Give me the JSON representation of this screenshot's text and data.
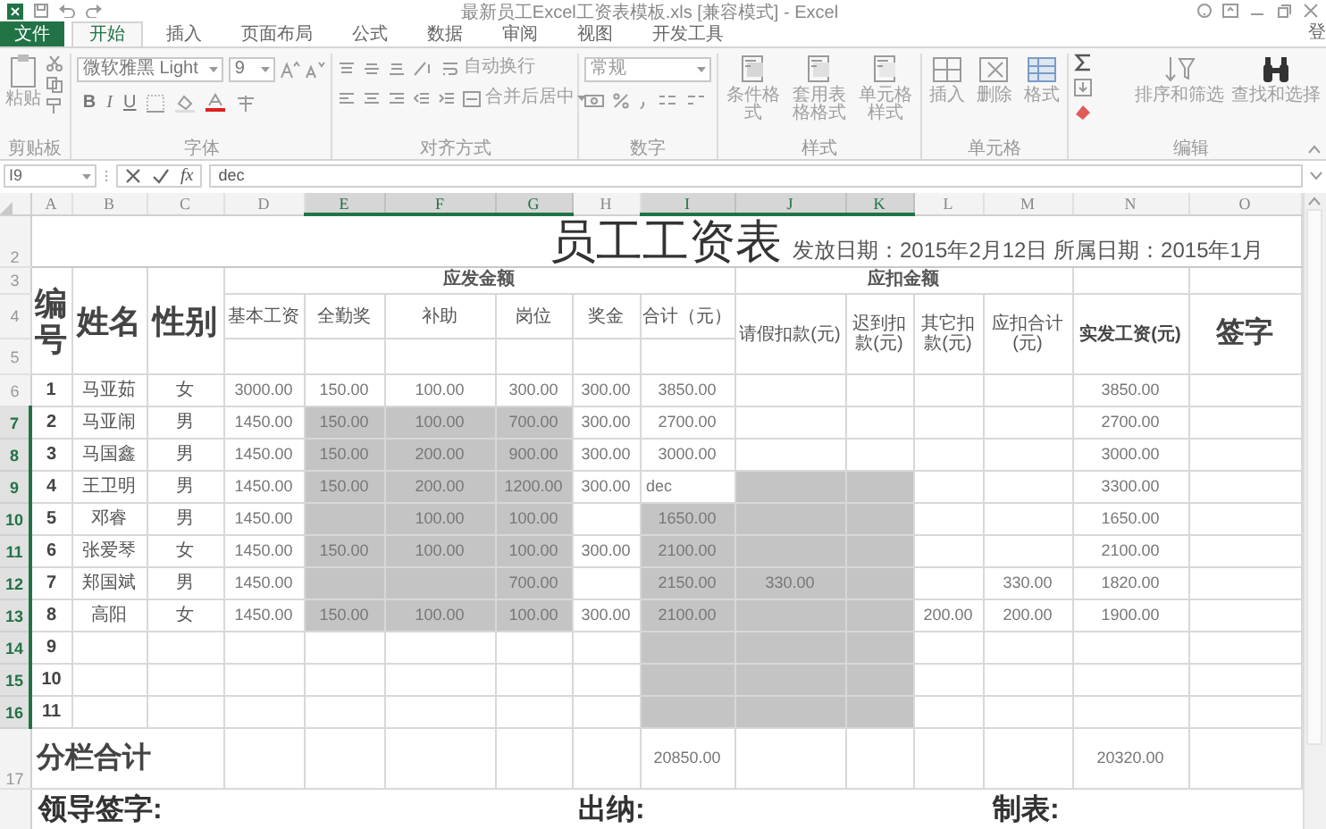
{
  "window": {
    "title": "最新员工Excel工资表模板.xls  [兼容模式] - Excel"
  },
  "ribbon": {
    "tabs": [
      {
        "label": "文件",
        "kind": "backstage",
        "selected": false
      },
      {
        "label": "开始",
        "kind": "tab",
        "selected": true
      },
      {
        "label": "插入",
        "kind": "tab",
        "selected": false
      },
      {
        "label": "页面布局",
        "kind": "tab",
        "selected": false
      },
      {
        "label": "公式",
        "kind": "tab",
        "selected": false
      },
      {
        "label": "数据",
        "kind": "tab",
        "selected": false
      },
      {
        "label": "审阅",
        "kind": "tab",
        "selected": false
      },
      {
        "label": "视图",
        "kind": "tab",
        "selected": false
      },
      {
        "label": "开发工具",
        "kind": "tab",
        "selected": false
      }
    ],
    "account": "登",
    "clipboard": {
      "label": "剪贴板",
      "paste": "粘贴"
    },
    "font": {
      "label": "字体",
      "font_name": "微软雅黑 Light",
      "font_size": "9",
      "bold": "B",
      "italic": "I",
      "underline": "U"
    },
    "alignment": {
      "label": "对齐方式",
      "wrap_text": "自动换行",
      "merge_center": "合并后居中"
    },
    "number": {
      "label": "数字",
      "format": "常规"
    },
    "styles": {
      "label": "样式",
      "buttons": [
        "条件格式",
        "套用表格格式",
        "单元格样式"
      ]
    },
    "cells": {
      "label": "单元格",
      "buttons": [
        "插入",
        "删除",
        "格式"
      ]
    },
    "editing": {
      "label": "编辑",
      "buttons": [
        "排序和筛选",
        "查找和选择"
      ]
    }
  },
  "formula_bar": {
    "name_box": "I9",
    "fx": "fx",
    "value": "dec"
  },
  "sheet": {
    "columns": [
      {
        "label": "A",
        "selected": false
      },
      {
        "label": "B",
        "selected": false
      },
      {
        "label": "C",
        "selected": false
      },
      {
        "label": "D",
        "selected": false
      },
      {
        "label": "E",
        "selected": true
      },
      {
        "label": "F",
        "selected": true
      },
      {
        "label": "G",
        "selected": true
      },
      {
        "label": "H",
        "selected": false
      },
      {
        "label": "I",
        "selected": true
      },
      {
        "label": "J",
        "selected": true
      },
      {
        "label": "K",
        "selected": true
      },
      {
        "label": "L",
        "selected": false
      },
      {
        "label": "M",
        "selected": false
      },
      {
        "label": "N",
        "selected": false
      },
      {
        "label": "O",
        "selected": false
      }
    ],
    "header_row_numbers": [
      "2",
      "3",
      "4",
      "5"
    ],
    "title": "员工工资表",
    "date_line": "发放日期：2015年2月12日 所属日期：2015年1月",
    "group_headers": [
      "应发金额",
      "应扣金额"
    ],
    "headers": [
      "编号",
      "姓名",
      "性别",
      "基本工资",
      "全勤奖",
      "补助",
      "岗位",
      "奖金",
      "合计（元）",
      "请假扣款(元)",
      "迟到扣款(元)",
      "其它扣款(元)",
      "应扣合计(元)",
      "实发工资(元)",
      "签字"
    ],
    "rows": [
      {
        "row_number": "6",
        "selected": false,
        "cells": [
          {
            "text": "1",
            "selected": false
          },
          {
            "text": "马亚茹",
            "selected": false
          },
          {
            "text": "女",
            "selected": false
          },
          {
            "text": "3000.00",
            "selected": false
          },
          {
            "text": "150.00",
            "selected": false
          },
          {
            "text": "100.00",
            "selected": false
          },
          {
            "text": "300.00",
            "selected": false
          },
          {
            "text": "300.00",
            "selected": false
          },
          {
            "text": "3850.00",
            "selected": false
          },
          {
            "selected": false
          },
          {
            "selected": false
          },
          {
            "selected": false
          },
          {
            "selected": false
          },
          {
            "text": "3850.00",
            "selected": false
          },
          {
            "selected": false
          }
        ]
      },
      {
        "row_number": "7",
        "selected": true,
        "cells": [
          {
            "text": "2",
            "selected": false
          },
          {
            "text": "马亚闹",
            "selected": false
          },
          {
            "text": "男",
            "selected": false
          },
          {
            "text": "1450.00",
            "selected": false
          },
          {
            "text": "150.00",
            "selected": true
          },
          {
            "text": "100.00",
            "selected": true
          },
          {
            "text": "700.00",
            "selected": true
          },
          {
            "text": "300.00",
            "selected": false
          },
          {
            "text": "2700.00",
            "selected": false
          },
          {
            "selected": false
          },
          {
            "selected": false
          },
          {
            "selected": false
          },
          {
            "selected": false
          },
          {
            "text": "2700.00",
            "selected": false
          },
          {
            "selected": false
          }
        ]
      },
      {
        "row_number": "8",
        "selected": true,
        "cells": [
          {
            "text": "3",
            "selected": false
          },
          {
            "text": "马国鑫",
            "selected": false
          },
          {
            "text": "男",
            "selected": false
          },
          {
            "text": "1450.00",
            "selected": false
          },
          {
            "text": "150.00",
            "selected": true
          },
          {
            "text": "200.00",
            "selected": true
          },
          {
            "text": "900.00",
            "selected": true
          },
          {
            "text": "300.00",
            "selected": false
          },
          {
            "text": "3000.00",
            "selected": false
          },
          {
            "selected": false
          },
          {
            "selected": false
          },
          {
            "selected": false
          },
          {
            "selected": false
          },
          {
            "text": "3000.00",
            "selected": false
          },
          {
            "selected": false
          }
        ]
      },
      {
        "row_number": "9",
        "selected": true,
        "cells": [
          {
            "text": "4",
            "selected": false
          },
          {
            "text": "王卫明",
            "selected": false
          },
          {
            "text": "男",
            "selected": false
          },
          {
            "text": "1450.00",
            "selected": false
          },
          {
            "text": "150.00",
            "selected": true
          },
          {
            "text": "200.00",
            "selected": true
          },
          {
            "text": "1200.00",
            "selected": true
          },
          {
            "text": "300.00",
            "selected": false
          },
          {
            "text": "dec",
            "selected": false
          },
          {
            "selected": true
          },
          {
            "selected": true
          },
          {
            "selected": false
          },
          {
            "selected": false
          },
          {
            "text": "3300.00",
            "selected": false
          },
          {
            "selected": false
          }
        ]
      },
      {
        "row_number": "10",
        "selected": true,
        "cells": [
          {
            "text": "5",
            "selected": false
          },
          {
            "text": "邓睿",
            "selected": false
          },
          {
            "text": "男",
            "selected": false
          },
          {
            "text": "1450.00",
            "selected": false
          },
          {
            "selected": true
          },
          {
            "text": "100.00",
            "selected": true
          },
          {
            "text": "100.00",
            "selected": true
          },
          {
            "selected": false
          },
          {
            "text": "1650.00",
            "selected": true
          },
          {
            "selected": true
          },
          {
            "selected": true
          },
          {
            "selected": false
          },
          {
            "selected": false
          },
          {
            "text": "1650.00",
            "selected": false
          },
          {
            "selected": false
          }
        ]
      },
      {
        "row_number": "11",
        "selected": true,
        "cells": [
          {
            "text": "6",
            "selected": false
          },
          {
            "text": "张爱琴",
            "selected": false
          },
          {
            "text": "女",
            "selected": false
          },
          {
            "text": "1450.00",
            "selected": false
          },
          {
            "text": "150.00",
            "selected": true
          },
          {
            "text": "100.00",
            "selected": true
          },
          {
            "text": "100.00",
            "selected": true
          },
          {
            "text": "300.00",
            "selected": false
          },
          {
            "text": "2100.00",
            "selected": true
          },
          {
            "selected": true
          },
          {
            "selected": true
          },
          {
            "selected": false
          },
          {
            "selected": false
          },
          {
            "text": "2100.00",
            "selected": false
          },
          {
            "selected": false
          }
        ]
      },
      {
        "row_number": "12",
        "selected": true,
        "cells": [
          {
            "text": "7",
            "selected": false
          },
          {
            "text": "郑国斌",
            "selected": false
          },
          {
            "text": "男",
            "selected": false
          },
          {
            "text": "1450.00",
            "selected": false
          },
          {
            "selected": true
          },
          {
            "selected": true
          },
          {
            "text": "700.00",
            "selected": true
          },
          {
            "selected": false
          },
          {
            "text": "2150.00",
            "selected": true
          },
          {
            "text": "330.00",
            "selected": true
          },
          {
            "selected": true
          },
          {
            "selected": false
          },
          {
            "text": "330.00",
            "selected": false
          },
          {
            "text": "1820.00",
            "selected": false
          },
          {
            "selected": false
          }
        ]
      },
      {
        "row_number": "13",
        "selected": true,
        "cells": [
          {
            "text": "8",
            "selected": false
          },
          {
            "text": "高阳",
            "selected": false
          },
          {
            "text": "女",
            "selected": false
          },
          {
            "text": "1450.00",
            "selected": false
          },
          {
            "text": "150.00",
            "selected": true
          },
          {
            "text": "100.00",
            "selected": true
          },
          {
            "text": "100.00",
            "selected": true
          },
          {
            "text": "300.00",
            "selected": false
          },
          {
            "text": "2100.00",
            "selected": true
          },
          {
            "selected": true
          },
          {
            "selected": true
          },
          {
            "text": "200.00",
            "selected": false
          },
          {
            "text": "200.00",
            "selected": false
          },
          {
            "text": "1900.00",
            "selected": false
          },
          {
            "selected": false
          }
        ]
      },
      {
        "row_number": "14",
        "selected": true,
        "cells": [
          {
            "text": "9",
            "selected": false
          },
          {
            "selected": false
          },
          {
            "selected": false
          },
          {
            "selected": false
          },
          {
            "selected": false
          },
          {
            "selected": false
          },
          {
            "selected": false
          },
          {
            "selected": false
          },
          {
            "selected": true
          },
          {
            "selected": true
          },
          {
            "selected": true
          },
          {
            "selected": false
          },
          {
            "selected": false
          },
          {
            "selected": false
          },
          {
            "selected": false
          }
        ]
      },
      {
        "row_number": "15",
        "selected": true,
        "cells": [
          {
            "text": "10",
            "selected": false
          },
          {
            "selected": false
          },
          {
            "selected": false
          },
          {
            "selected": false
          },
          {
            "selected": false
          },
          {
            "selected": false
          },
          {
            "selected": false
          },
          {
            "selected": false
          },
          {
            "selected": true
          },
          {
            "selected": true
          },
          {
            "selected": true
          },
          {
            "selected": false
          },
          {
            "selected": false
          },
          {
            "selected": false
          },
          {
            "selected": false
          }
        ]
      },
      {
        "row_number": "16",
        "selected": true,
        "cells": [
          {
            "text": "11",
            "selected": false
          },
          {
            "selected": false
          },
          {
            "selected": false
          },
          {
            "selected": false
          },
          {
            "selected": false
          },
          {
            "selected": false
          },
          {
            "selected": false
          },
          {
            "selected": false
          },
          {
            "selected": true
          },
          {
            "selected": true
          },
          {
            "selected": true
          },
          {
            "selected": false
          },
          {
            "selected": false
          },
          {
            "selected": false
          },
          {
            "selected": false
          }
        ]
      }
    ],
    "total_row": {
      "row_number": "17",
      "label": "分栏合计",
      "cells": [
        {},
        {},
        {},
        {},
        {},
        {
          "text": "20850.00"
        },
        {},
        {},
        {},
        {},
        {
          "text": "20320.00"
        },
        {}
      ]
    },
    "footer": [
      "领导签字:",
      "出纳:",
      "制表:"
    ]
  }
}
